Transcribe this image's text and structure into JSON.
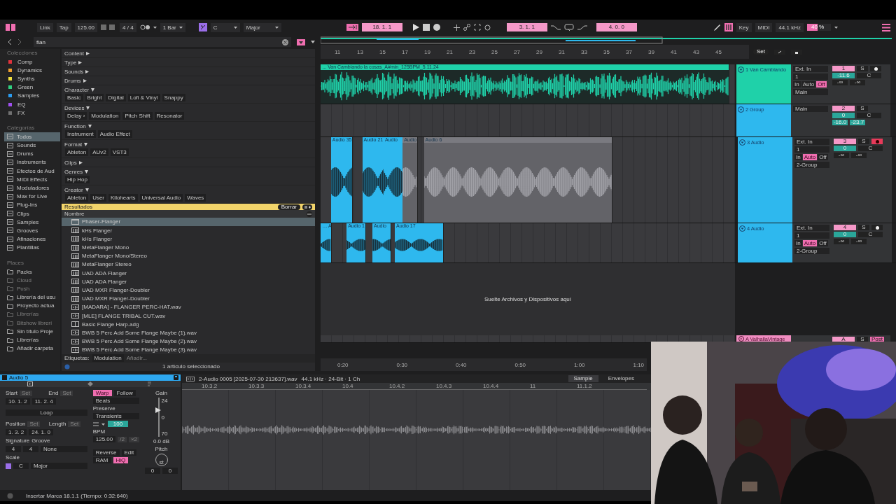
{
  "toolbar": {
    "link": "Link",
    "tap": "Tap",
    "tempo": "125.00",
    "signature": "4 / 4",
    "quantize": "1 Bar",
    "key": "C",
    "scale": "Major",
    "position": "18.  1.  1",
    "loop_start": "3.  1.  1",
    "loop_length": "4.  0.  0",
    "key_map": "Key",
    "midi_map": "MIDI",
    "sample_rate": "44.1 kHz",
    "cpu": {
      "reading": "40 %",
      "level": 0.45
    }
  },
  "browser": {
    "search": "flan",
    "collections_title": "Colecciones",
    "collections": [
      {
        "label": "Comp",
        "color": "#e0323c"
      },
      {
        "label": "Dynamics",
        "color": "#f0a030"
      },
      {
        "label": "Synths",
        "color": "#f0e040"
      },
      {
        "label": "Green",
        "color": "#30d080"
      },
      {
        "label": "Samples",
        "color": "#2a9cf0"
      },
      {
        "label": "EQ",
        "color": "#a050f0"
      },
      {
        "label": "FX",
        "color": "#707070"
      }
    ],
    "categories_title": "Categorías",
    "categories": [
      {
        "label": "Todos",
        "selected": true
      },
      {
        "label": "Sounds",
        "selected": false
      },
      {
        "label": "Drums",
        "selected": false
      },
      {
        "label": "Instruments",
        "selected": false
      },
      {
        "label": "Efectos de Aud",
        "selected": false
      },
      {
        "label": "MIDI Effects",
        "selected": false
      },
      {
        "label": "Moduladores",
        "selected": false
      },
      {
        "label": "Max for Live",
        "selected": false
      },
      {
        "label": "Plug-Ins",
        "selected": false
      },
      {
        "label": "Clips",
        "selected": false
      },
      {
        "label": "Samples",
        "selected": false
      },
      {
        "label": "Grooves",
        "selected": false
      },
      {
        "label": "Afinaciones",
        "selected": false
      },
      {
        "label": "Plantillas",
        "selected": false
      }
    ],
    "places_title": "Places",
    "places": [
      {
        "label": "Packs",
        "disabled": false
      },
      {
        "label": "Cloud",
        "disabled": true
      },
      {
        "label": "Push",
        "disabled": true
      },
      {
        "label": "Librería del usu",
        "disabled": false
      },
      {
        "label": "Proyecto actua",
        "disabled": false
      },
      {
        "label": "Librerías",
        "disabled": true
      },
      {
        "label": "Bitshow librerí",
        "disabled": true
      },
      {
        "label": "Sin título Proje",
        "disabled": false
      },
      {
        "label": "Librerías",
        "disabled": false
      },
      {
        "label": "Añadir carpeta",
        "disabled": false
      }
    ],
    "filters": [
      {
        "label": "Content",
        "expanded": false
      },
      {
        "label": "Type",
        "expanded": false
      },
      {
        "label": "Sounds",
        "expanded": false
      },
      {
        "label": "Drums",
        "expanded": false
      },
      {
        "label": "Character",
        "expanded": true,
        "tags": [
          "Basic",
          "Bright",
          "Digital",
          "Lofi & Vinyl",
          "Snappy"
        ]
      },
      {
        "label": "Devices",
        "expanded": true,
        "tags": [
          "Delay ›",
          "Modulation",
          "Pitch Shift",
          "Resonator"
        ]
      },
      {
        "label": "Function",
        "expanded": true,
        "tags": [
          "Instrument",
          "Audio Effect"
        ]
      },
      {
        "label": "Format",
        "expanded": true,
        "tags": [
          "Ableton",
          "AUv2",
          "VST3"
        ]
      },
      {
        "label": "Clips",
        "expanded": false
      },
      {
        "label": "Genres",
        "expanded": true,
        "tags": [
          "Hip Hop"
        ]
      },
      {
        "label": "Creator",
        "expanded": true,
        "tags": [
          "Ableton",
          "User",
          "Kilohearts",
          "Universal Audio",
          "Waves"
        ]
      }
    ],
    "results": {
      "title": "Resultados",
      "clear": "Borrar",
      "column": "Nombre",
      "items": [
        {
          "label": "Phaser-Flanger",
          "kind": "device",
          "selected": true
        },
        {
          "label": "kHs Flanger",
          "kind": "plugin",
          "selected": false
        },
        {
          "label": "kHs Flanger",
          "kind": "plugin",
          "selected": false
        },
        {
          "label": "MetaFlanger Mono",
          "kind": "plugin",
          "selected": false
        },
        {
          "label": "MetaFlanger Mono/Stereo",
          "kind": "plugin",
          "selected": false
        },
        {
          "label": "MetaFlanger Stereo",
          "kind": "plugin",
          "selected": false
        },
        {
          "label": "UAD ADA Flanger",
          "kind": "plugin",
          "selected": false
        },
        {
          "label": "UAD ADA Flanger",
          "kind": "plugin",
          "selected": false
        },
        {
          "label": "UAD MXR Flanger-Doubler",
          "kind": "plugin",
          "selected": false
        },
        {
          "label": "UAD MXR Flanger-Doubler",
          "kind": "plugin",
          "selected": false
        },
        {
          "label": "[MADARA] - FLANGER PERC-HAT.wav",
          "kind": "sample",
          "selected": false
        },
        {
          "label": "[MLE] FLANGE TRIBAL CUT.wav",
          "kind": "sample",
          "selected": false
        },
        {
          "label": "Basic Flange Harp.adg",
          "kind": "preset",
          "selected": false
        },
        {
          "label": "BWB 5 Perc Add Some Flange Maybe (1).wav",
          "kind": "sample",
          "selected": false
        },
        {
          "label": "BWB 5 Perc Add Some Flange Maybe (2).wav",
          "kind": "sample",
          "selected": false
        },
        {
          "label": "BWB 5 Perc Add Some Flange Maybe (3).wav",
          "kind": "sample",
          "selected": false
        }
      ]
    },
    "tags_label": "Etiquetas:",
    "tags": [
      "Modulation"
    ],
    "tag_placeholder": "Añadir...",
    "status": "1 artículo seleccionado"
  },
  "arrangement": {
    "ruler": [
      "11",
      "13",
      "15",
      "17",
      "19",
      "21",
      "23",
      "25",
      "27",
      "29",
      "31",
      "33",
      "35",
      "37",
      "39",
      "41",
      "43",
      "45"
    ],
    "set": "Set",
    "tracks": [
      {
        "name": "1 Van Cambiando",
        "kind": "audio",
        "color": "#1fd1a9",
        "input": "Ext. In",
        "channel": "1",
        "monitor": [
          {
            "label": "In",
            "selected": false
          },
          {
            "label": "Auto",
            "selected": false
          },
          {
            "label": "Off",
            "selected": true
          }
        ],
        "output": "Main",
        "number": "1",
        "solo": "S",
        "arm": false,
        "volume": "-11.6",
        "pan": "C",
        "peaks": [
          "-∞",
          "-∞"
        ],
        "clips": [
          {
            "name": "... Van Cambiando la cosas_A#min_125BPM_5.11.24",
            "active": true,
            "selected": true
          }
        ]
      },
      {
        "name": "2 Group",
        "kind": "group",
        "color": "#2eb8ee",
        "output": "Main",
        "number": "2",
        "solo": "S",
        "volume": "0",
        "pan": "C",
        "peaks": [
          "-16.0",
          "-23.7"
        ],
        "children": [
          {
            "name": "3 Audio",
            "kind": "audio",
            "color": "#2eb8ee",
            "input": "Ext. In",
            "channel": "1",
            "monitor": [
              {
                "label": "In",
                "selected": false
              },
              {
                "label": "Auto",
                "selected": true
              },
              {
                "label": "Off",
                "selected": false
              }
            ],
            "output": "2-Group",
            "number": "3",
            "solo": "S",
            "arm": true,
            "volume": "0",
            "pan": "C",
            "peaks": [
              "-∞",
              "-∞"
            ],
            "clips": [
              {
                "name": "Audio 35",
                "active": true,
                "selected": false
              },
              {
                "name": "Audio 21",
                "active": true,
                "selected": false
              },
              {
                "name": "Audio",
                "active": true,
                "selected": false
              },
              {
                "name": "Audio",
                "active": false,
                "selected": false
              },
              {
                "name": "Audio 6",
                "active": false,
                "selected": false
              }
            ]
          },
          {
            "name": "4 Audio",
            "kind": "audio",
            "color": "#2eb8ee",
            "input": "Ext. In",
            "channel": "1",
            "monitor": [
              {
                "label": "In",
                "selected": false
              },
              {
                "label": "Auto",
                "selected": true
              },
              {
                "label": "Off",
                "selected": false
              }
            ],
            "output": "2-Group",
            "number": "4",
            "solo": "S",
            "arm": false,
            "volume": "0",
            "pan": "C",
            "peaks": [
              "-∞",
              "-∞"
            ],
            "clips": [
              {
                "name": "… A",
                "active": true,
                "selected": false
              },
              {
                "name": "Audio 1",
                "active": true,
                "selected": false
              },
              {
                "name": "Audio",
                "active": true,
                "selected": false
              },
              {
                "name": "Audio 17",
                "active": true,
                "selected": false
              }
            ]
          }
        ]
      }
    ],
    "drop_hint": "Suelte Archivos y Dispositivos aquí",
    "return_track": {
      "name": "A ValhallaVintage",
      "color": "#f08cc0",
      "number": "A",
      "solo": "S",
      "post": "Post"
    },
    "time_ruler": [
      "0:20",
      "0:30",
      "0:40",
      "0:50",
      "1:00",
      "1:10"
    ]
  },
  "clip_view": {
    "title": "Audio 5",
    "file": "2-Audio 0005 [2025-07-30 213637].wav",
    "info": "44.1 kHz · 24-Bit · 1 Ch",
    "tabs": [
      {
        "label": "Sample",
        "selected": true
      },
      {
        "label": "Envelopes",
        "selected": false
      }
    ],
    "start": {
      "label": "Start",
      "set": "Set",
      "value": "10.  1.  2"
    },
    "end": {
      "label": "End",
      "set": "Set",
      "value": "11.  2.  4"
    },
    "loop": {
      "label": "Loop",
      "on": false
    },
    "position": {
      "label": "Position",
      "set": "Set",
      "value": "1.  3.  2"
    },
    "length": {
      "label": "Length",
      "set": "Set",
      "value": "24.  1.  0"
    },
    "signature": {
      "label": "Signature",
      "numerator": "4",
      "denominator": "4"
    },
    "groove": {
      "label": "Groove",
      "value": "None"
    },
    "scale": {
      "label": "Scale",
      "key": "C",
      "mode": "Major"
    },
    "warp": {
      "label": "Warp",
      "on": true
    },
    "follow": {
      "label": "Follow",
      "on": false
    },
    "warp_mode": "Beats",
    "preserve_label": "Preserve",
    "preserve": "Transients",
    "envelope": "100",
    "bpm_label": "BPM",
    "bpm": "125.00",
    "halve": "/2",
    "double": "×2",
    "reverse": "Reverse",
    "edit": "Edit",
    "ram": {
      "label": "RAM",
      "on": false
    },
    "hiq": {
      "label": "HiQ",
      "on": true
    },
    "gain": {
      "label": "Gain",
      "max": "24",
      "mid": "0",
      "min": "70",
      "value": "0.0 dB",
      "level": 0.67
    },
    "pitch": {
      "label": "Pitch",
      "unit": "st",
      "semitones": "0",
      "cents": "0"
    },
    "ruler": [
      "10.3.2",
      "10.3.3",
      "10.3.4",
      "10.4",
      "10.4.2",
      "10.4.3",
      "10.4.4",
      "11",
      "11.1.2"
    ]
  },
  "status": "Insertar Marca 18.1.1 (Tiempo: 0:32:640)"
}
